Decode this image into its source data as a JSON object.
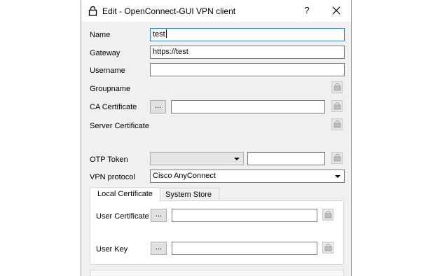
{
  "window": {
    "title": "Edit - OpenConnect-GUI VPN client",
    "help_label": "?"
  },
  "form": {
    "name": {
      "label": "Name",
      "value": "test"
    },
    "gateway": {
      "label": "Gateway",
      "value": "https://test"
    },
    "username": {
      "label": "Username",
      "value": ""
    },
    "groupname": {
      "label": "Groupname"
    },
    "ca_certificate": {
      "label": "CA Certificate",
      "browse_label": "...",
      "value": ""
    },
    "server_certificate": {
      "label": "Server Certificate"
    },
    "otp_token": {
      "label": "OTP Token",
      "type_value": "",
      "value": ""
    },
    "vpn_protocol": {
      "label": "VPN protocol",
      "selected": "Cisco AnyConnect"
    }
  },
  "tabs": [
    {
      "label": "Local Certificate",
      "active": true
    },
    {
      "label": "System Store",
      "active": false
    }
  ],
  "local_certificate": {
    "user_certificate": {
      "label": "User Certificate",
      "browse_label": "...",
      "value": ""
    },
    "user_key": {
      "label": "User Key",
      "browse_label": "...",
      "value": ""
    }
  },
  "icons": {
    "title": "lock-icon",
    "close": "close-icon",
    "clear": "clear-icon"
  },
  "colors": {
    "focus_border": "#3c7fb1",
    "dialog_bg": "#f0f0f0"
  }
}
